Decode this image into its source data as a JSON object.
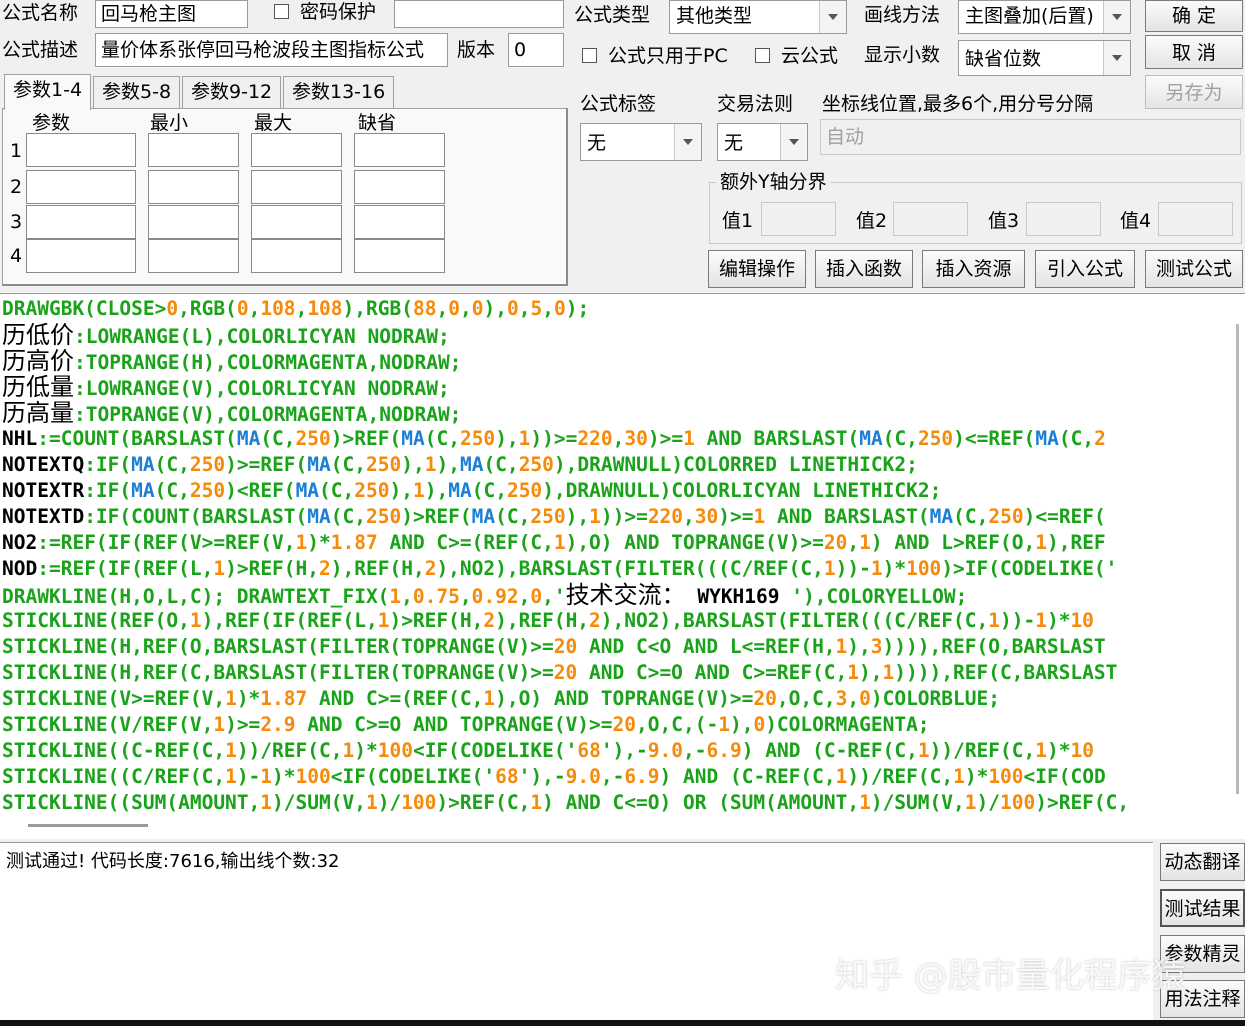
{
  "header": {
    "name_label": "公式名称",
    "name_value": "回马枪主图",
    "password_label": "密码保护",
    "desc_label": "公式描述",
    "desc_value": "量价体系张停回马枪波段主图指标公式",
    "version_label": "版本",
    "version_value": "0",
    "type_label": "公式类型",
    "type_value": "其他类型",
    "draw_label": "画线方法",
    "draw_value": "主图叠加(后置)",
    "pc_only_label": "公式只用于PC",
    "cloud_label": "云公式",
    "decimal_label": "显示小数",
    "decimal_value": "缺省位数"
  },
  "buttons": {
    "ok": "确  定",
    "cancel": "取  消",
    "save_as": "另存为",
    "edit": "编辑操作",
    "insert_func": "插入函数",
    "insert_res": "插入资源",
    "import": "引入公式",
    "test": "测试公式",
    "dyn_translate": "动态翻译",
    "test_result": "测试结果",
    "param_wizard": "参数精灵",
    "usage_notes": "用法注释"
  },
  "tabs": [
    "参数1-4",
    "参数5-8",
    "参数9-12",
    "参数13-16"
  ],
  "params": {
    "headers": [
      "参数",
      "最小",
      "最大",
      "缺省"
    ],
    "rows": [
      "1",
      "2",
      "3",
      "4"
    ]
  },
  "right": {
    "tag_label": "公式标签",
    "tag_value": "无",
    "trade_label": "交易法则",
    "trade_value": "无",
    "coord_label": "坐标线位置,最多6个,用分号分隔",
    "coord_value": "自动",
    "yaxis_label": "额外Y轴分界",
    "v1": "值1",
    "v2": "值2",
    "v3": "值3",
    "v4": "值4"
  },
  "colors": {
    "green": "#1aa31a",
    "blue": "#1b7fd6",
    "orange": "#f58a0b",
    "black": "#000000"
  },
  "code_lines": [
    [
      [
        "g",
        "DRAWGBK(CLOSE>"
      ],
      [
        "o",
        "0"
      ],
      [
        "g",
        ",RGB("
      ],
      [
        "o",
        "0"
      ],
      [
        "g",
        ","
      ],
      [
        "o",
        "108"
      ],
      [
        "g",
        ","
      ],
      [
        "o",
        "108"
      ],
      [
        "g",
        "),RGB("
      ],
      [
        "o",
        "88"
      ],
      [
        "g",
        ","
      ],
      [
        "o",
        "0"
      ],
      [
        "g",
        ","
      ],
      [
        "o",
        "0"
      ],
      [
        "g",
        "),"
      ],
      [
        "o",
        "0"
      ],
      [
        "g",
        ","
      ],
      [
        "o",
        "5"
      ],
      [
        "g",
        ","
      ],
      [
        "o",
        "0"
      ],
      [
        "g",
        ");"
      ]
    ],
    [
      [
        "v",
        "历低价"
      ],
      [
        "g",
        ":LOWRANGE(L),COLORLICYAN NODRAW;"
      ]
    ],
    [
      [
        "v",
        "历高价"
      ],
      [
        "g",
        ":TOPRANGE(H),COLORMAGENTA,NODRAW;"
      ]
    ],
    [
      [
        "v",
        "历低量"
      ],
      [
        "g",
        ":LOWRANGE(V),COLORLICYAN NODRAW;"
      ]
    ],
    [
      [
        "v",
        "历高量"
      ],
      [
        "g",
        ":TOPRANGE(V),COLORMAGENTA,NODRAW;"
      ]
    ],
    [
      [
        "k",
        "NHL"
      ],
      [
        "g",
        ":=COUNT(BARSLAST("
      ],
      [
        "b",
        "MA"
      ],
      [
        "g",
        "(C,"
      ],
      [
        "o",
        "250"
      ],
      [
        "g",
        ")>REF("
      ],
      [
        "b",
        "MA"
      ],
      [
        "g",
        "(C,"
      ],
      [
        "o",
        "250"
      ],
      [
        "g",
        "),"
      ],
      [
        "o",
        "1"
      ],
      [
        "g",
        "))>="
      ],
      [
        "o",
        "220"
      ],
      [
        "g",
        ","
      ],
      [
        "o",
        "30"
      ],
      [
        "g",
        ")>="
      ],
      [
        "o",
        "1"
      ],
      [
        "g",
        " AND BARSLAST("
      ],
      [
        "b",
        "MA"
      ],
      [
        "g",
        "(C,"
      ],
      [
        "o",
        "250"
      ],
      [
        "g",
        ")<=REF("
      ],
      [
        "b",
        "MA"
      ],
      [
        "g",
        "(C,"
      ],
      [
        "o",
        "2"
      ]
    ],
    [
      [
        "k",
        "NOTEXTQ"
      ],
      [
        "g",
        ":IF("
      ],
      [
        "b",
        "MA"
      ],
      [
        "g",
        "(C,"
      ],
      [
        "o",
        "250"
      ],
      [
        "g",
        ")>=REF("
      ],
      [
        "b",
        "MA"
      ],
      [
        "g",
        "(C,"
      ],
      [
        "o",
        "250"
      ],
      [
        "g",
        "),"
      ],
      [
        "o",
        "1"
      ],
      [
        "g",
        "),"
      ],
      [
        "b",
        "MA"
      ],
      [
        "g",
        "(C,"
      ],
      [
        "o",
        "250"
      ],
      [
        "g",
        "),DRAWNULL)COLORRED LINETHICK2;"
      ]
    ],
    [
      [
        "k",
        "NOTEXTR"
      ],
      [
        "g",
        ":IF("
      ],
      [
        "b",
        "MA"
      ],
      [
        "g",
        "(C,"
      ],
      [
        "o",
        "250"
      ],
      [
        "g",
        ")<REF("
      ],
      [
        "b",
        "MA"
      ],
      [
        "g",
        "(C,"
      ],
      [
        "o",
        "250"
      ],
      [
        "g",
        "),"
      ],
      [
        "o",
        "1"
      ],
      [
        "g",
        "),"
      ],
      [
        "b",
        "MA"
      ],
      [
        "g",
        "(C,"
      ],
      [
        "o",
        "250"
      ],
      [
        "g",
        "),DRAWNULL)COLORLICYAN LINETHICK2;"
      ]
    ],
    [
      [
        "k",
        "NOTEXTD"
      ],
      [
        "g",
        ":IF(COUNT(BARSLAST("
      ],
      [
        "b",
        "MA"
      ],
      [
        "g",
        "(C,"
      ],
      [
        "o",
        "250"
      ],
      [
        "g",
        ")>REF("
      ],
      [
        "b",
        "MA"
      ],
      [
        "g",
        "(C,"
      ],
      [
        "o",
        "250"
      ],
      [
        "g",
        "),"
      ],
      [
        "o",
        "1"
      ],
      [
        "g",
        "))>="
      ],
      [
        "o",
        "220"
      ],
      [
        "g",
        ","
      ],
      [
        "o",
        "30"
      ],
      [
        "g",
        ")>="
      ],
      [
        "o",
        "1"
      ],
      [
        "g",
        " AND BARSLAST("
      ],
      [
        "b",
        "MA"
      ],
      [
        "g",
        "(C,"
      ],
      [
        "o",
        "250"
      ],
      [
        "g",
        ")<=REF("
      ]
    ],
    [
      [
        "k",
        "NO2"
      ],
      [
        "g",
        ":=REF(IF(REF(V>=REF(V,"
      ],
      [
        "o",
        "1"
      ],
      [
        "g",
        ")*"
      ],
      [
        "o",
        "1.87"
      ],
      [
        "g",
        " AND C>=(REF(C,"
      ],
      [
        "o",
        "1"
      ],
      [
        "g",
        "),O) AND TOPRANGE(V)>="
      ],
      [
        "o",
        "20"
      ],
      [
        "g",
        ","
      ],
      [
        "o",
        "1"
      ],
      [
        "g",
        ") AND L>REF(O,"
      ],
      [
        "o",
        "1"
      ],
      [
        "g",
        "),REF"
      ]
    ],
    [
      [
        "k",
        "NOD"
      ],
      [
        "g",
        ":=REF(IF(REF(L,"
      ],
      [
        "o",
        "1"
      ],
      [
        "g",
        ")>REF(H,"
      ],
      [
        "o",
        "2"
      ],
      [
        "g",
        "),REF(H,"
      ],
      [
        "o",
        "2"
      ],
      [
        "g",
        "),NO2),BARSLAST(FILTER(((C/REF(C,"
      ],
      [
        "o",
        "1"
      ],
      [
        "g",
        "))-"
      ],
      [
        "o",
        "1"
      ],
      [
        "g",
        ")*"
      ],
      [
        "o",
        "100"
      ],
      [
        "g",
        ")>IF(CODELIKE('"
      ]
    ],
    [
      [
        "g",
        "DRAWKLINE(H,O,L,C); DRAWTEXT_FIX("
      ],
      [
        "o",
        "1"
      ],
      [
        "g",
        ","
      ],
      [
        "o",
        "0.75"
      ],
      [
        "g",
        ","
      ],
      [
        "o",
        "0.92"
      ],
      [
        "g",
        ","
      ],
      [
        "o",
        "0"
      ],
      [
        "g",
        ",'"
      ],
      [
        "v",
        "技术交流："
      ],
      [
        "k",
        " WYKH169 "
      ],
      [
        "g",
        "'),COLORYELLOW;"
      ]
    ],
    [
      [
        "g",
        "STICKLINE(REF(O,"
      ],
      [
        "o",
        "1"
      ],
      [
        "g",
        "),REF(IF(REF(L,"
      ],
      [
        "o",
        "1"
      ],
      [
        "g",
        ")>REF(H,"
      ],
      [
        "o",
        "2"
      ],
      [
        "g",
        "),REF(H,"
      ],
      [
        "o",
        "2"
      ],
      [
        "g",
        "),NO2),BARSLAST(FILTER(((C/REF(C,"
      ],
      [
        "o",
        "1"
      ],
      [
        "g",
        "))-"
      ],
      [
        "o",
        "1"
      ],
      [
        "g",
        ")*"
      ],
      [
        "o",
        "10"
      ]
    ],
    [
      [
        "g",
        "STICKLINE(H,REF(O,BARSLAST(FILTER(TOPRANGE(V)>="
      ],
      [
        "o",
        "20"
      ],
      [
        "g",
        " AND C<O AND L<=REF(H,"
      ],
      [
        "o",
        "1"
      ],
      [
        "g",
        "),"
      ],
      [
        "o",
        "3"
      ],
      [
        "g",
        ")))),REF(O,BARSLAST"
      ]
    ],
    [
      [
        "g",
        "STICKLINE(H,REF(C,BARSLAST(FILTER(TOPRANGE(V)>="
      ],
      [
        "o",
        "20"
      ],
      [
        "g",
        " AND C>=O AND C>=REF(C,"
      ],
      [
        "o",
        "1"
      ],
      [
        "g",
        "),"
      ],
      [
        "o",
        "1"
      ],
      [
        "g",
        ")))),REF(C,BARSLAST"
      ]
    ],
    [
      [
        "g",
        "STICKLINE(V>=REF(V,"
      ],
      [
        "o",
        "1"
      ],
      [
        "g",
        ")*"
      ],
      [
        "o",
        "1.87"
      ],
      [
        "g",
        " AND C>=(REF(C,"
      ],
      [
        "o",
        "1"
      ],
      [
        "g",
        "),O) AND TOPRANGE(V)>="
      ],
      [
        "o",
        "20"
      ],
      [
        "g",
        ",O,C,"
      ],
      [
        "o",
        "3"
      ],
      [
        "g",
        ","
      ],
      [
        "o",
        "0"
      ],
      [
        "g",
        ")COLORBLUE;"
      ]
    ],
    [
      [
        "g",
        "STICKLINE(V/REF(V,"
      ],
      [
        "o",
        "1"
      ],
      [
        "g",
        ")>="
      ],
      [
        "o",
        "2.9"
      ],
      [
        "g",
        " AND C>=O AND TOPRANGE(V)>="
      ],
      [
        "o",
        "20"
      ],
      [
        "g",
        ",O,C,(-"
      ],
      [
        "o",
        "1"
      ],
      [
        "g",
        "),"
      ],
      [
        "o",
        "0"
      ],
      [
        "g",
        ")COLORMAGENTA;"
      ]
    ],
    [
      [
        "g",
        "STICKLINE((C-REF(C,"
      ],
      [
        "o",
        "1"
      ],
      [
        "g",
        "))/REF(C,"
      ],
      [
        "o",
        "1"
      ],
      [
        "g",
        ")*"
      ],
      [
        "o",
        "100"
      ],
      [
        "g",
        "<IF(CODELIKE('"
      ],
      [
        "o",
        "68"
      ],
      [
        "g",
        "'),-"
      ],
      [
        "o",
        "9.0"
      ],
      [
        "g",
        ",-"
      ],
      [
        "o",
        "6.9"
      ],
      [
        "g",
        ") AND (C-REF(C,"
      ],
      [
        "o",
        "1"
      ],
      [
        "g",
        "))/REF(C,"
      ],
      [
        "o",
        "1"
      ],
      [
        "g",
        ")*"
      ],
      [
        "o",
        "10"
      ]
    ],
    [
      [
        "g",
        "STICKLINE((C/REF(C,"
      ],
      [
        "o",
        "1"
      ],
      [
        "g",
        ")-"
      ],
      [
        "o",
        "1"
      ],
      [
        "g",
        ")*"
      ],
      [
        "o",
        "100"
      ],
      [
        "g",
        "<IF(CODELIKE('"
      ],
      [
        "o",
        "68"
      ],
      [
        "g",
        "'),-"
      ],
      [
        "o",
        "9.0"
      ],
      [
        "g",
        ",-"
      ],
      [
        "o",
        "6.9"
      ],
      [
        "g",
        ") AND (C-REF(C,"
      ],
      [
        "o",
        "1"
      ],
      [
        "g",
        "))/REF(C,"
      ],
      [
        "o",
        "1"
      ],
      [
        "g",
        ")*"
      ],
      [
        "o",
        "100"
      ],
      [
        "g",
        "<IF(COD"
      ]
    ],
    [
      [
        "g",
        "STICKLINE((SUM(AMOUNT,"
      ],
      [
        "o",
        "1"
      ],
      [
        "g",
        ")/SUM(V,"
      ],
      [
        "o",
        "1"
      ],
      [
        "g",
        ")/"
      ],
      [
        "o",
        "100"
      ],
      [
        "g",
        ")>REF(C,"
      ],
      [
        "o",
        "1"
      ],
      [
        "g",
        ") AND C<=O) OR (SUM(AMOUNT,"
      ],
      [
        "o",
        "1"
      ],
      [
        "g",
        ")/SUM(V,"
      ],
      [
        "o",
        "1"
      ],
      [
        "g",
        ")/"
      ],
      [
        "o",
        "100"
      ],
      [
        "g",
        ")>REF(C,"
      ]
    ]
  ],
  "status": "测试通过! 代码长度:7616,输出线个数:32",
  "watermark": "知乎 @股市量化程序猿"
}
